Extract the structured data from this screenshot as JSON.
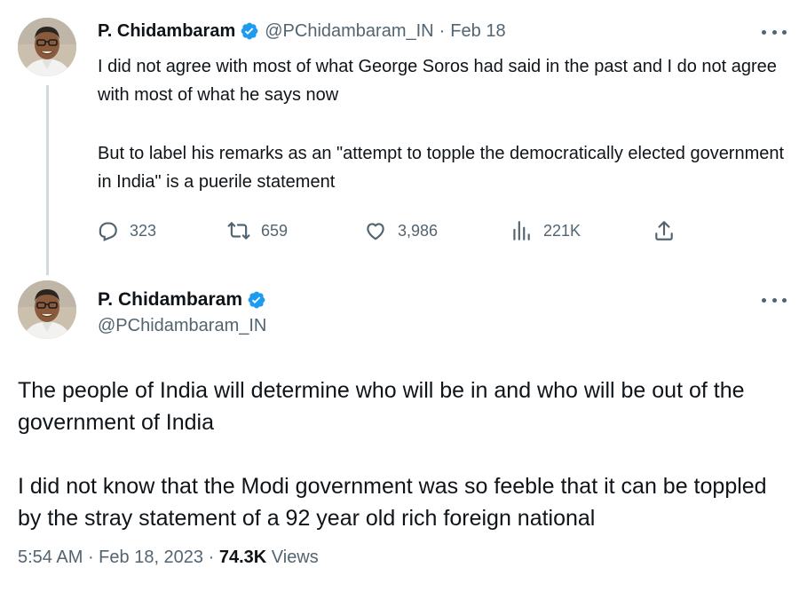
{
  "tweet1": {
    "author_name": "P. Chidambaram",
    "handle": "@PChidambaram_IN",
    "separator": "·",
    "date": "Feb 18",
    "paragraphs": [
      "I did not agree with most of what George Soros had said in the past and I do not agree with most of what he says now",
      "But to label his remarks as an \"attempt to topple the democratically elected government in India\" is a puerile statement"
    ],
    "stats": {
      "replies": "323",
      "retweets": "659",
      "likes": "3,986",
      "views": "221K"
    }
  },
  "tweet2": {
    "author_name": "P. Chidambaram",
    "handle": "@PChidambaram_IN",
    "paragraphs": [
      "The people of India will determine who will be in and who will be out of the government of India",
      "I did not know that the Modi government was so feeble that it can be toppled by the stray statement of a 92 year old rich foreign national"
    ],
    "time": "5:54 AM",
    "date": "Feb 18, 2023",
    "views_count": "74.3K",
    "views_label": "Views"
  },
  "colors": {
    "text": "#0f1419",
    "muted": "#536471",
    "verified_blue": "#1d9bf0",
    "thread_line": "#cfd9de"
  },
  "icons": [
    "verified-badge-icon",
    "reply-icon",
    "retweet-icon",
    "like-icon",
    "views-icon",
    "share-icon",
    "more-options-icon"
  ]
}
